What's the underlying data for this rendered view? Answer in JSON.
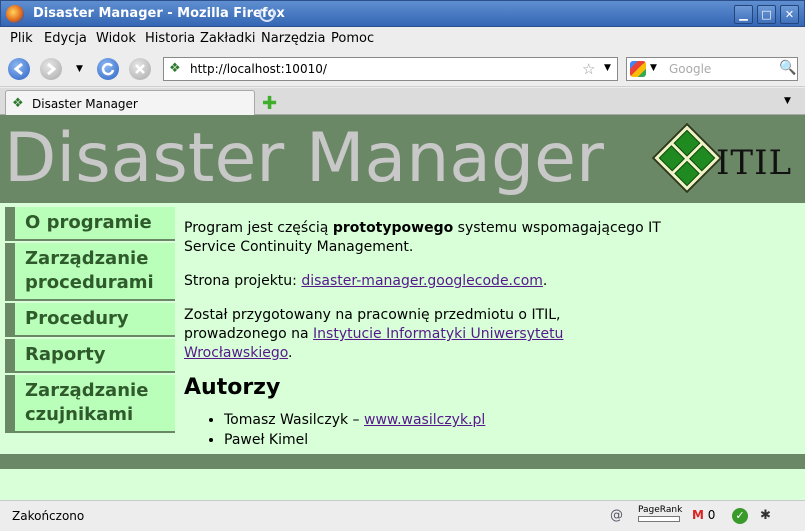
{
  "window": {
    "title": "Disaster Manager - Mozilla Firefox",
    "min_label": "▁",
    "max_label": "□",
    "close_label": "✕"
  },
  "menu": [
    "Plik",
    "Edycja",
    "Widok",
    "Historia",
    "Zakładki",
    "Narzędzia",
    "Pomoc"
  ],
  "nav": {
    "url": "http://localhost:10010/",
    "search_placeholder": "Google"
  },
  "tab": {
    "label": "Disaster Manager"
  },
  "page": {
    "banner_title": "Disaster Manager",
    "logo_text": "ITIL",
    "sidebar": [
      "O programie",
      "Zarządzanie procedurami",
      "Procedury",
      "Raporty",
      "Zarządzanie czujnikami"
    ],
    "intro_prefix": "Program jest częścią ",
    "intro_bold": "prototypowego",
    "intro_suffix": " systemu wspomagającego IT Service Continuity Management.",
    "project_label": "Strona projektu: ",
    "project_link": "disaster-manager.googlecode.com",
    "project_end": ".",
    "course_text": "Został przygotowany na pracownię przedmiotu o ITIL, prowadzonego na ",
    "course_link": "Instytucie Informatyki Uniwersytetu Wrocławskiego",
    "course_end": ".",
    "authors_heading": "Autorzy",
    "author1_name": "Tomasz Wasilczyk – ",
    "author1_link": "www.wasilczyk.pl",
    "author2_name": "Paweł Kimel"
  },
  "status": {
    "text": "Zakończono",
    "pagerank_label": "PageRank",
    "mail_count": "0"
  }
}
